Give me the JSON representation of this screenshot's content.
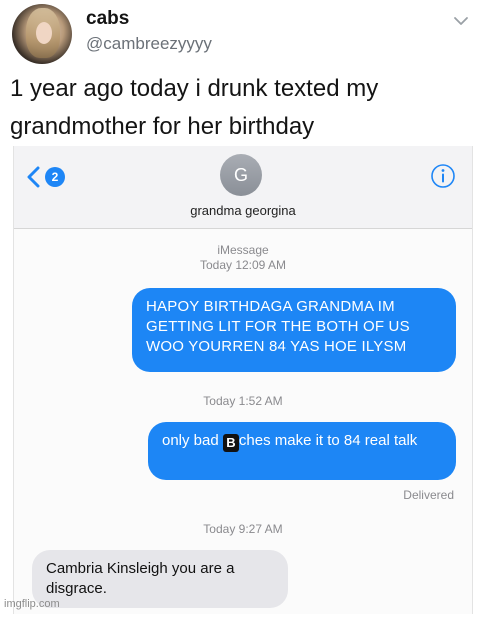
{
  "tweet": {
    "name": "cabs",
    "handle": "@cambreezyyyy",
    "text": "1 year ago today i drunk texted my grandmother for her birthday"
  },
  "imessage": {
    "back_badge": "2",
    "contact_initial": "G",
    "contact_name": "grandma georgina",
    "service_label": "iMessage",
    "timestamp_1": "Today 12:09 AM",
    "message_1": "HAPOY BIRTHDAGA GRANDMA IM GETTING LIT FOR THE BOTH OF US WOO YOURREN 84 YAS HOE ILYSM",
    "timestamp_2": "Today 1:52 AM",
    "message_2": {
      "before": "only bad ",
      "censor": "B",
      "after": "ches make it to 84 real talk"
    },
    "delivered": "Delivered",
    "timestamp_3": "Today 9:27 AM",
    "message_3": "Cambria Kinsleigh you are a disgrace."
  },
  "watermark": "imgflip.com",
  "colors": {
    "imessage_blue": "#1d86f5",
    "received_gray": "#e6e6ea",
    "ios_link_blue": "#1e86f6"
  },
  "icons": {
    "back": "chevron-left-icon",
    "info": "info-icon",
    "menu": "chevron-down-icon"
  }
}
